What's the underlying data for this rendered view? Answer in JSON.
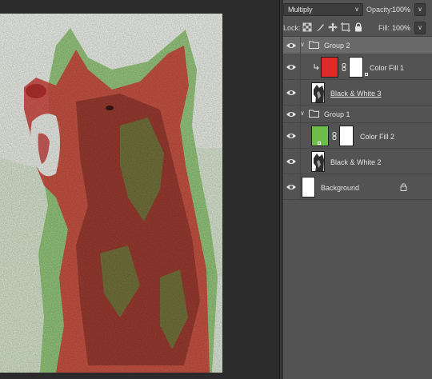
{
  "layers_panel": {
    "blend_mode": "Multiply",
    "opacity_label": "Opacity:",
    "opacity_value": "100%",
    "lock_label": "Lock:",
    "fill_label": "Fill:",
    "fill_value": "100%",
    "layers": [
      {
        "name": "Group 2",
        "kind": "group",
        "expanded": true,
        "visible": true,
        "selected": true
      },
      {
        "name": "Color Fill 1",
        "kind": "fill",
        "color": "#e02a2a",
        "clipped": true,
        "visible": true
      },
      {
        "name": "Black & White 3",
        "kind": "adjustment",
        "visible": true,
        "underlined": true
      },
      {
        "name": "Group 1",
        "kind": "group",
        "expanded": true,
        "visible": true
      },
      {
        "name": "Color Fill 2",
        "kind": "fill",
        "color": "#6fbd4b",
        "visible": true
      },
      {
        "name": "Black & White 2",
        "kind": "adjustment",
        "visible": true
      },
      {
        "name": "Background",
        "kind": "background",
        "locked": true,
        "visible": true
      }
    ]
  },
  "icons": {
    "visibility": "eye-icon",
    "group": "folder-icon",
    "expand": "chevron-down-icon",
    "link": "chain-link-icon",
    "clip": "clipping-arrow-icon",
    "lock": "padlock-icon",
    "lock_tools": [
      "lock-transparent-pixels-icon",
      "lock-image-pixels-icon",
      "lock-position-icon",
      "lock-artboard-icon",
      "lock-all-icon"
    ]
  },
  "colors": {
    "panel_bg": "#535353",
    "selected_row": "#6a6a6a",
    "duotone_red": "#d63a3a",
    "duotone_green": "#86c66a"
  }
}
